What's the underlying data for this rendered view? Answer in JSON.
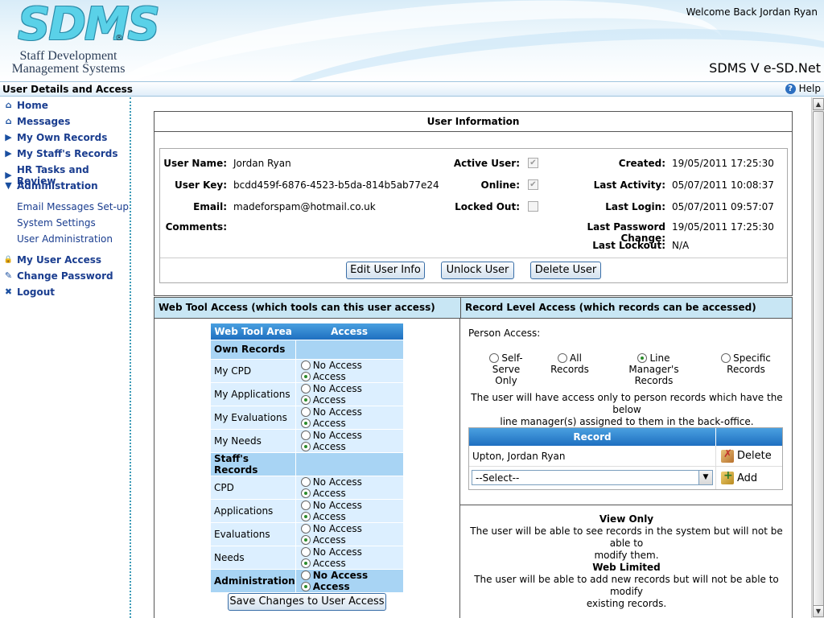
{
  "header": {
    "logo_text": "SDMS",
    "logo_reg": "®",
    "logo_sub_line1": "Staff Development",
    "logo_sub_line2": "Management Systems",
    "welcome": "Welcome Back Jordan Ryan",
    "version": "SDMS V e-SD.Net"
  },
  "titlebar": {
    "title": "User Details and Access",
    "help": "Help",
    "help_icon": "?"
  },
  "sidebar": {
    "items": [
      {
        "label": "Home",
        "icon": "home-icon",
        "glyph": "⌂"
      },
      {
        "label": "Messages",
        "icon": "messages-icon",
        "glyph": "⌂"
      },
      {
        "label": "My Own Records",
        "icon": "arrow-right-icon",
        "glyph": "▶"
      },
      {
        "label": "My Staff's Records",
        "icon": "arrow-right-icon",
        "glyph": "▶"
      },
      {
        "label": "HR Tasks and Review",
        "icon": "arrow-right-icon",
        "glyph": "▶"
      },
      {
        "label": "Administration",
        "icon": "arrow-down-icon",
        "glyph": "▼"
      }
    ],
    "sub_items": [
      "Email Messages Set-up",
      "System Settings",
      "User Administration"
    ],
    "bottom_items": [
      {
        "label": "My User Access",
        "icon": "lock-icon",
        "glyph": "🔒"
      },
      {
        "label": "Change Password",
        "icon": "key-icon",
        "glyph": "✎"
      },
      {
        "label": "Logout",
        "icon": "logout-x-icon",
        "glyph": "✖"
      }
    ]
  },
  "user_info": {
    "title": "User Information",
    "user_name_label": "User Name:",
    "user_name": "Jordan Ryan",
    "user_key_label": "User Key:",
    "user_key": "bcdd459f-6876-4523-b5da-814b5ab77e24",
    "email_label": "Email:",
    "email": "madeforspam@hotmail.co.uk",
    "comments_label": "Comments:",
    "active_label": "Active User:",
    "online_label": "Online:",
    "locked_label": "Locked Out:",
    "active_checked": true,
    "online_checked": true,
    "locked_checked": false,
    "check_glyph": "✔",
    "created_label": "Created:",
    "created": "19/05/2011 17:25:30",
    "last_activity_label": "Last Activity:",
    "last_activity": "05/07/2011 10:08:37",
    "last_login_label": "Last Login:",
    "last_login": "05/07/2011 09:57:07",
    "last_pw_label": "Last Password Change:",
    "last_pw": "19/05/2011 17:25:30",
    "last_lockout_label": "Last Lockout:",
    "last_lockout": "N/A",
    "buttons": {
      "edit": "Edit User Info",
      "unlock": "Unlock User",
      "delete": "Delete User"
    }
  },
  "web_tool_access": {
    "heading": "Web Tool Access (which tools can this user access)",
    "col_area": "Web Tool Area",
    "col_access": "Access",
    "no_access_label": "No Access",
    "access_label": "Access",
    "groups": [
      {
        "name": "Own Records",
        "rows": [
          "My CPD",
          "My Applications",
          "My Evaluations",
          "My Needs"
        ]
      },
      {
        "name": "Staff's Records",
        "rows": [
          "CPD",
          "Applications",
          "Evaluations",
          "Needs"
        ]
      }
    ],
    "admin_row": "Administration",
    "save_button": "Save Changes to User Access"
  },
  "record_level_access": {
    "heading": "Record Level Access (which records can be accessed)",
    "person_access_label": "Person Access:",
    "options": [
      {
        "line1": "Self-Serve",
        "line2": "Only",
        "selected": false
      },
      {
        "line1": "All",
        "line2": "Records",
        "selected": false
      },
      {
        "line1": "Line Manager's",
        "line2": "Records",
        "selected": true
      },
      {
        "line1": "Specific",
        "line2": "Records",
        "selected": false
      }
    ],
    "description_line1": "The user will have access only to person records which have the below",
    "description_line2": "line manager(s) assigned to them in the back-office.",
    "record_header": "Record",
    "record_row": "Upton, Jordan Ryan",
    "delete_label": "Delete",
    "select_value": "--Select--",
    "add_label": "Add",
    "view_only_title": "View Only",
    "view_only_line1": "The user will be able to see records in the system but will not be able to",
    "view_only_line2": "modify them.",
    "web_limited_title": "Web Limited",
    "web_limited_line1": "The user will be able to add new records but will not be able to modify",
    "web_limited_line2": "existing records."
  }
}
